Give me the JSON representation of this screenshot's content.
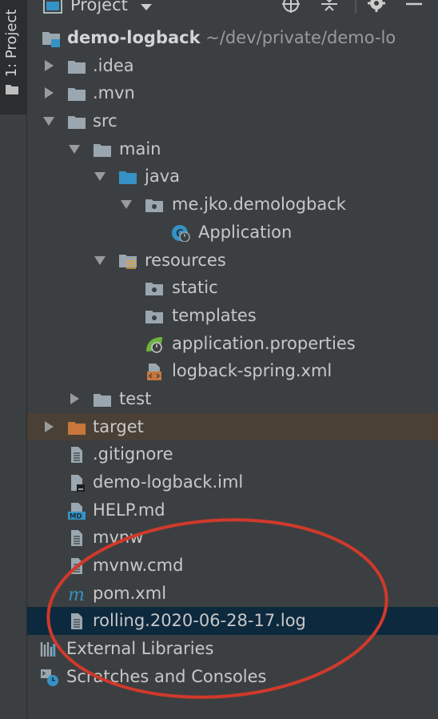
{
  "stripe": {
    "label": "1: Project"
  },
  "toolbar": {
    "title": "Project"
  },
  "tree": {
    "root": {
      "name": "demo-logback",
      "path": "~/dev/private/demo-lo"
    },
    "idea": ".idea",
    "mvn": ".mvn",
    "src": "src",
    "main": "main",
    "java": "java",
    "package": "me.jko.demologback",
    "application": "Application",
    "resources": "resources",
    "static": "static",
    "templates": "templates",
    "props": "application.properties",
    "logback": "logback-spring.xml",
    "test": "test",
    "target": "target",
    "gitignore": ".gitignore",
    "iml": "demo-logback.iml",
    "help": "HELP.md",
    "mvnw": "mvnw",
    "mvnwcmd": "mvnw.cmd",
    "pom": "pom.xml",
    "log": "rolling.2020-06-28-17.log",
    "external": "External Libraries",
    "scratches": "Scratches and Consoles"
  },
  "icons": {
    "folder": "folder-icon",
    "file": "file-icon",
    "maven": "maven-icon",
    "spring": "spring-icon"
  },
  "colors": {
    "background": "#3c3f41",
    "selection": "#0d293e",
    "excluded_row": "#4a4036",
    "folder": "#9aa7b0",
    "source_folder": "#3592c4",
    "excluded_folder": "#c8763b",
    "annotation": "#d0392b"
  }
}
